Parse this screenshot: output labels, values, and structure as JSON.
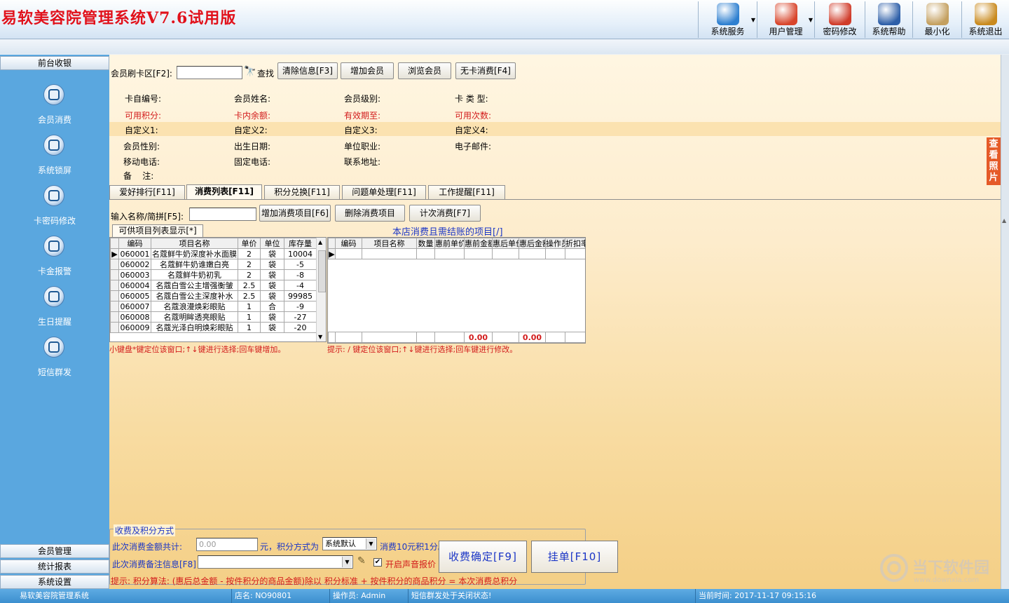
{
  "app": {
    "title": "易软美容院管理系统V7.6试用版"
  },
  "toolbar": [
    {
      "label": "系统服务",
      "icon": "globe-icon",
      "color": "#2d7fd0",
      "dropdown": true
    },
    {
      "label": "用户管理",
      "icon": "users-icon",
      "color": "#d8452b",
      "dropdown": true
    },
    {
      "label": "密码修改",
      "icon": "brush-icon",
      "color": "#d03c2a",
      "dropdown": false
    },
    {
      "label": "系统帮助",
      "icon": "book-icon",
      "color": "#2e5fa8",
      "dropdown": false
    },
    {
      "label": "最小化",
      "icon": "window-icon",
      "color": "#c4a060",
      "dropdown": false
    },
    {
      "label": "系统退出",
      "icon": "exit-door-icon",
      "color": "#c98a1e",
      "dropdown": false
    }
  ],
  "sidebar": {
    "header": "前台收银",
    "items": [
      {
        "label": "会员消费",
        "icon": "member-consume-icon"
      },
      {
        "label": "系统锁屏",
        "icon": "lock-screen-icon"
      },
      {
        "label": "卡密码修改",
        "icon": "card-password-icon"
      },
      {
        "label": "卡金报警",
        "icon": "card-alarm-icon"
      },
      {
        "label": "生日提醒",
        "icon": "birthday-icon"
      },
      {
        "label": "短信群发",
        "icon": "sms-icon"
      }
    ],
    "footer": [
      "会员管理",
      "统计报表",
      "系统设置"
    ]
  },
  "member_bar": {
    "card_label": "会员刷卡区[F2]:",
    "card_value": "",
    "find_label": "查找",
    "buttons": [
      "清除信息[F3]",
      "增加会员",
      "浏览会员",
      "无卡消费[F4]"
    ]
  },
  "member_info": {
    "row1": [
      "卡自编号:",
      "会员姓名:",
      "会员级别:",
      "卡 类 型:"
    ],
    "row2": [
      "可用积分:",
      "卡内余额:",
      "有效期至:",
      "可用次数:"
    ],
    "row3": [
      "自定义1:",
      "自定义2:",
      "自定义3:",
      "自定义4:"
    ],
    "row4": [
      "会员性别:",
      "出生日期:",
      "单位职业:",
      "电子邮件:"
    ],
    "row5": [
      "移动电话:",
      "固定电话:",
      "联系地址:"
    ],
    "note": "备    注:",
    "photo_button": "查看照片"
  },
  "tabs": [
    "爱好排行[F11]",
    "消费列表[F11]",
    "积分兑换[F11]",
    "问题单处理[F11]",
    "工作提醒[F11]"
  ],
  "active_tab": 1,
  "consume": {
    "input_label": "输入名称/简拼[F5]:",
    "input_value": "",
    "buttons": [
      "增加消费项目[F6]",
      "删除消费项目",
      "计次消费[F7]"
    ],
    "list_tab": "可供项目列表显示[*]",
    "pending_title": "本店消费且需结账的项目[/]",
    "left_headers": [
      "编码",
      "项目名称",
      "单价",
      "单位",
      "库存量"
    ],
    "left_rows": [
      [
        "060001",
        "名蔻鲜牛奶深度补水面膜",
        "2",
        "袋",
        "10004"
      ],
      [
        "060002",
        "名蔻鲜牛奶谁嫩白亮",
        "2",
        "袋",
        "-5"
      ],
      [
        "060003",
        "名蔻鲜牛奶初乳",
        "2",
        "袋",
        "-8"
      ],
      [
        "060004",
        "名蔻白雪公主增强衡皱",
        "2.5",
        "袋",
        "-4"
      ],
      [
        "060005",
        "名蔻白雪公主深度补水",
        "2.5",
        "袋",
        "99985"
      ],
      [
        "060007",
        "名蔻浪漫焕彩眼贴",
        "1",
        "合",
        "-9"
      ],
      [
        "060008",
        "名蔻明眸透亮眼贴",
        "1",
        "袋",
        "-27"
      ],
      [
        "060009",
        "名蔻光泽白明焕彩眼贴",
        "1",
        "袋",
        "-20"
      ]
    ],
    "right_headers": [
      "编码",
      "项目名称",
      "数量",
      "惠前单价",
      "惠前金额",
      "惠后单价",
      "惠后金额",
      "操作员",
      "折扣率"
    ],
    "right_totals": {
      "before": "0.00",
      "after": "0.00"
    },
    "hint_left": "小键盘*键定位该窗口;↑↓键进行选择;回车键增加。",
    "hint_right": "提示: / 键定位该窗口;↑↓键进行选择;回车键进行修改。"
  },
  "payment": {
    "legend": "收费及积分方式",
    "total_label": "此次消费金额共计:",
    "total_value": "0.00",
    "unit_label": "元，积分方式为",
    "mode_value": "系统默认",
    "rule_text": "消费10元积1分。",
    "note_label": "此次消费备注信息[F8]",
    "note_value": "",
    "voice_label": "开启声音报价",
    "voice_checked": true,
    "formula": "提示: 积分算法: (惠后总金额 - 按件积分的商品金额)除以 积分标准 + 按件积分的商品积分 = 本次消费总积分",
    "confirm_button": "收费确定[F9]",
    "hold_button": "挂单[F10]"
  },
  "status": {
    "app": "易软美容院管理系统",
    "store": "店名: NO90801",
    "operator": "操作员: Admin",
    "sms": "短信群发处于关闭状态!",
    "time": "当前时间: 2017-11-17 09:15:16"
  },
  "watermark": {
    "text": "当下软件园",
    "url": "www.downxia.com"
  }
}
